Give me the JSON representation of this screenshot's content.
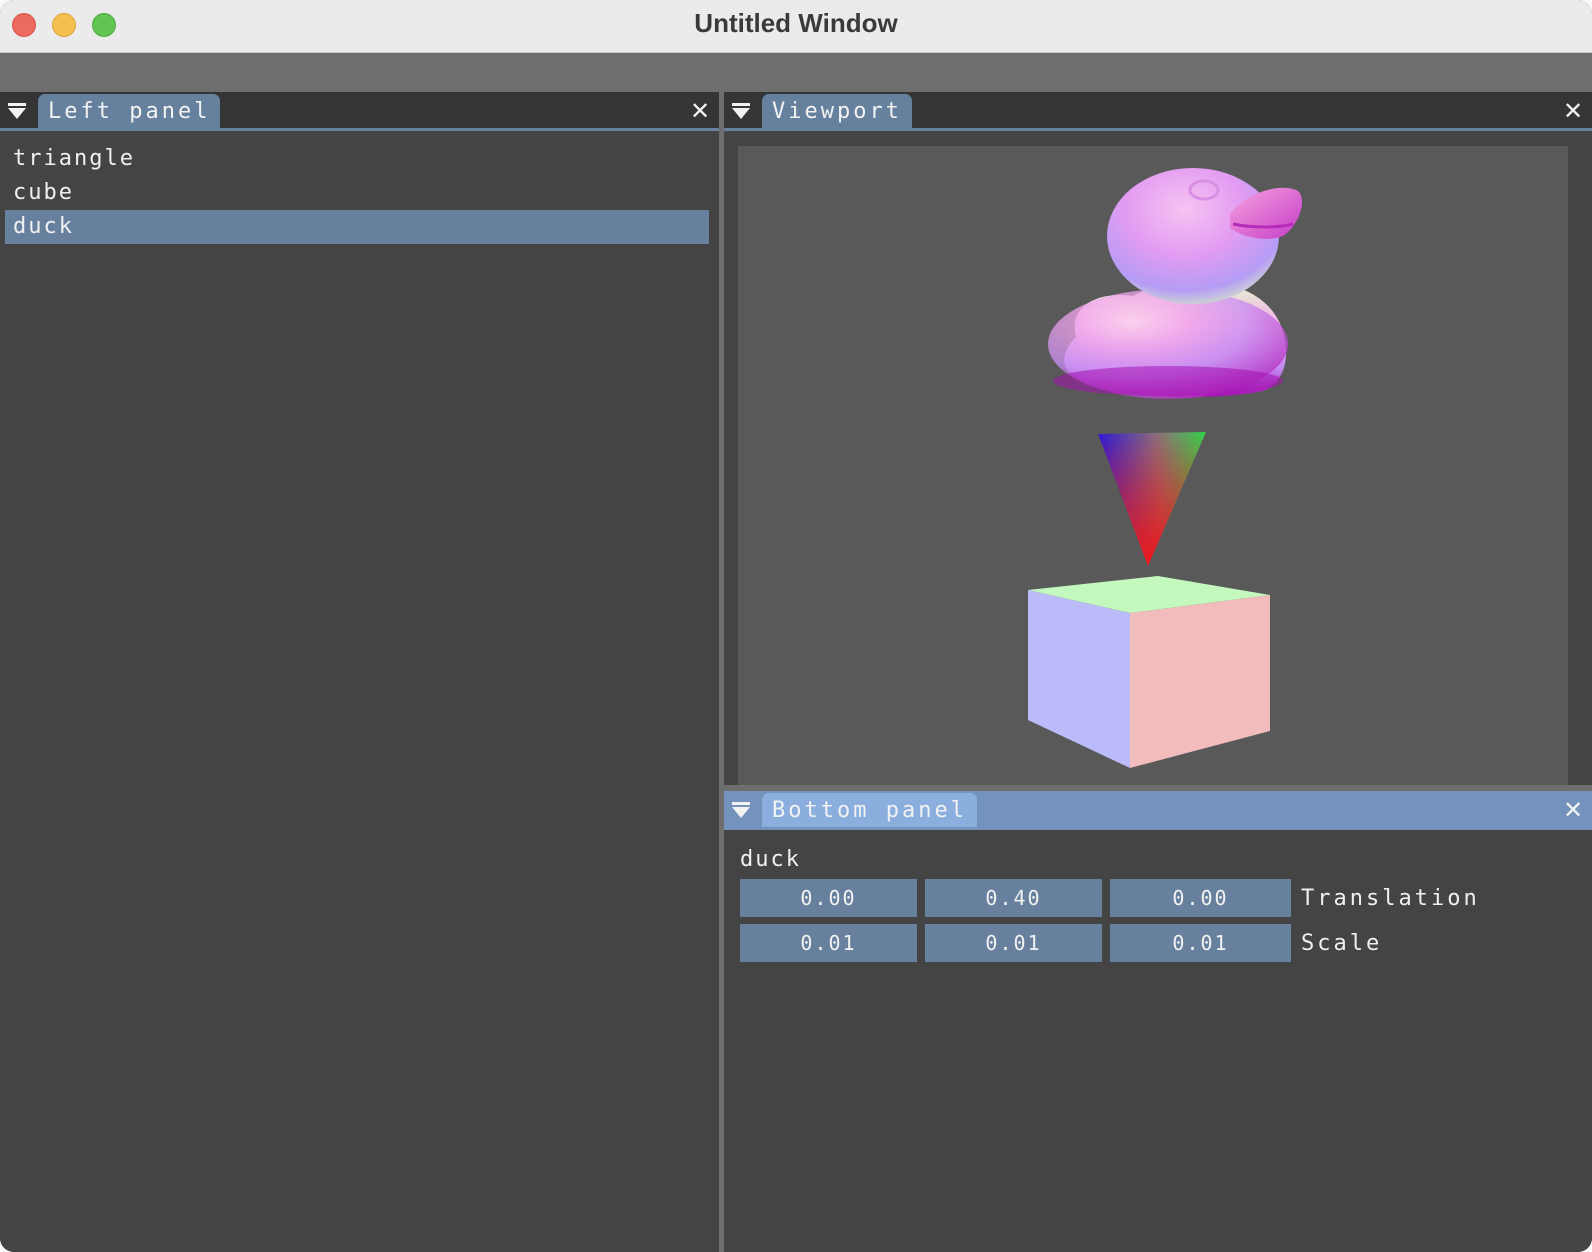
{
  "window": {
    "title": "Untitled Window"
  },
  "left_panel": {
    "tab_label": "Left panel",
    "items": [
      {
        "label": "triangle",
        "selected": false
      },
      {
        "label": "cube",
        "selected": false
      },
      {
        "label": "duck",
        "selected": true
      }
    ]
  },
  "viewport": {
    "tab_label": "Viewport"
  },
  "bottom_panel": {
    "tab_label": "Bottom panel",
    "object_name": "duck",
    "translation": {
      "x": "0.00",
      "y": "0.40",
      "z": "0.00",
      "label": "Translation"
    },
    "scale": {
      "x": "0.01",
      "y": "0.01",
      "z": "0.01",
      "label": "Scale"
    }
  },
  "icons": {
    "collapse": "triangle-down-icon",
    "close": "close-icon"
  },
  "colors": {
    "panel_bg": "#444444",
    "accent": "#66809e",
    "active_tab": "#8aaede",
    "viewport_bg": "#595959"
  }
}
